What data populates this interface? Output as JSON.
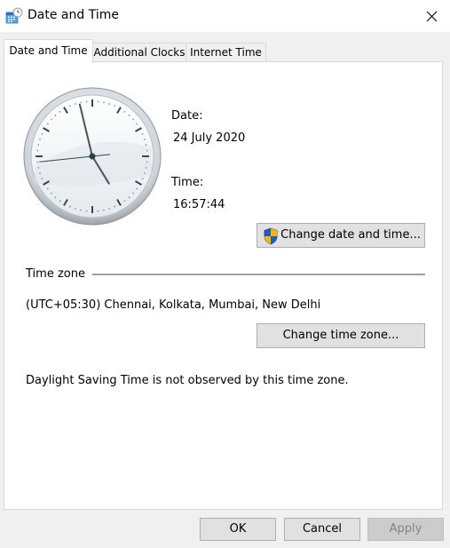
{
  "window": {
    "title": "Date and Time",
    "icon": "date-time-calendar-clock-icon",
    "close_icon": "close-icon"
  },
  "tabs": [
    {
      "label": "Date and Time",
      "active": true
    },
    {
      "label": "Additional Clocks",
      "active": false
    },
    {
      "label": "Internet Time",
      "active": false
    }
  ],
  "datetime": {
    "date_label": "Date:",
    "date_value": "24 July 2020",
    "time_label": "Time:",
    "time_value": "16:57:44",
    "clock": {
      "hour": 16,
      "minute": 57,
      "second": 44
    },
    "change_button": "Change date and time...",
    "change_button_icon": "uac-shield-icon"
  },
  "timezone": {
    "section_label": "Time zone",
    "value": "(UTC+05:30) Chennai, Kolkata, Mumbai, New Delhi",
    "change_button": "Change time zone...",
    "dst_note": "Daylight Saving Time is not observed by this time zone."
  },
  "footer": {
    "ok": "OK",
    "cancel": "Cancel",
    "apply": "Apply",
    "apply_enabled": false
  },
  "colors": {
    "shield_blue": "#1f5fbf",
    "shield_yellow": "#f2b705",
    "window_bg": "#f0f0f0",
    "panel_bg": "#ffffff"
  }
}
